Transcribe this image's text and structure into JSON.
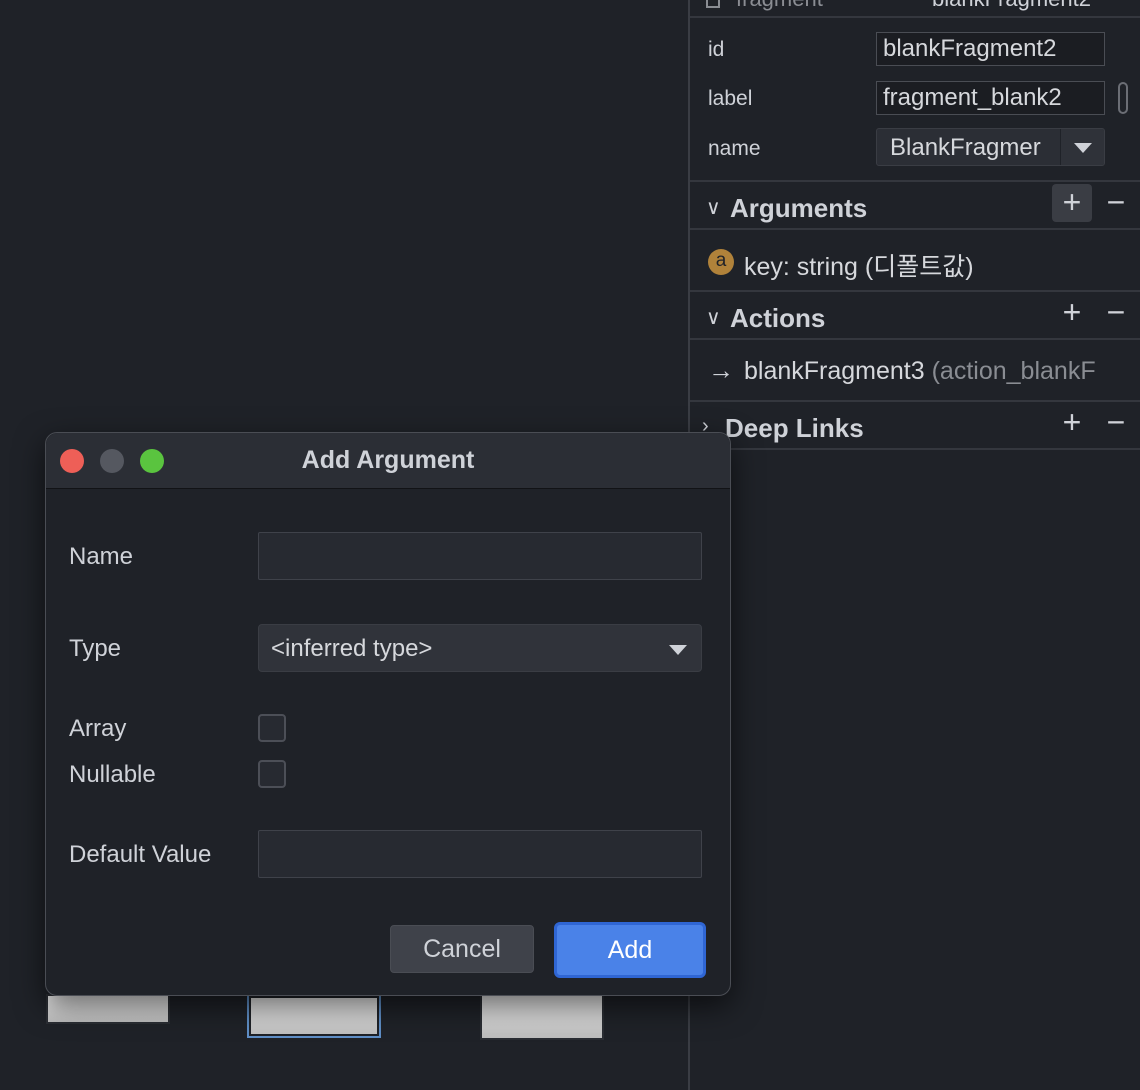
{
  "panel": {
    "top_row": {
      "label": "fragment",
      "value": "blankFragment2"
    },
    "attributes": {
      "id_label": "id",
      "id_value": "blankFragment2",
      "label_label": "label",
      "label_value": "fragment_blank2",
      "name_label": "name",
      "name_value": "BlankFragmer"
    },
    "sections": {
      "arguments": {
        "title": "Arguments",
        "add": "+",
        "remove": "−"
      },
      "actions": {
        "title": "Actions",
        "add": "+",
        "remove": "−"
      },
      "deep_links": {
        "title": "Deep Links",
        "add": "+",
        "remove": "−"
      }
    },
    "argument_item": {
      "badge": "a",
      "text": "key: string (디폴트값)"
    },
    "action_item": {
      "arrow": "→",
      "text": "blankFragment3",
      "detail": "(action_blankF"
    }
  },
  "dialog": {
    "title": "Add Argument",
    "name_label": "Name",
    "name_value": "",
    "type_label": "Type",
    "type_value": "<inferred type>",
    "array_label": "Array",
    "array_checked": false,
    "nullable_label": "Nullable",
    "nullable_checked": false,
    "default_label": "Default Value",
    "default_value": "",
    "cancel_label": "Cancel",
    "add_label": "Add"
  },
  "colors": {
    "background": "#1f2228",
    "accent": "#4a82e8",
    "badge": "#b0823a",
    "close": "#ee5f57",
    "zoom": "#5ac43f"
  }
}
